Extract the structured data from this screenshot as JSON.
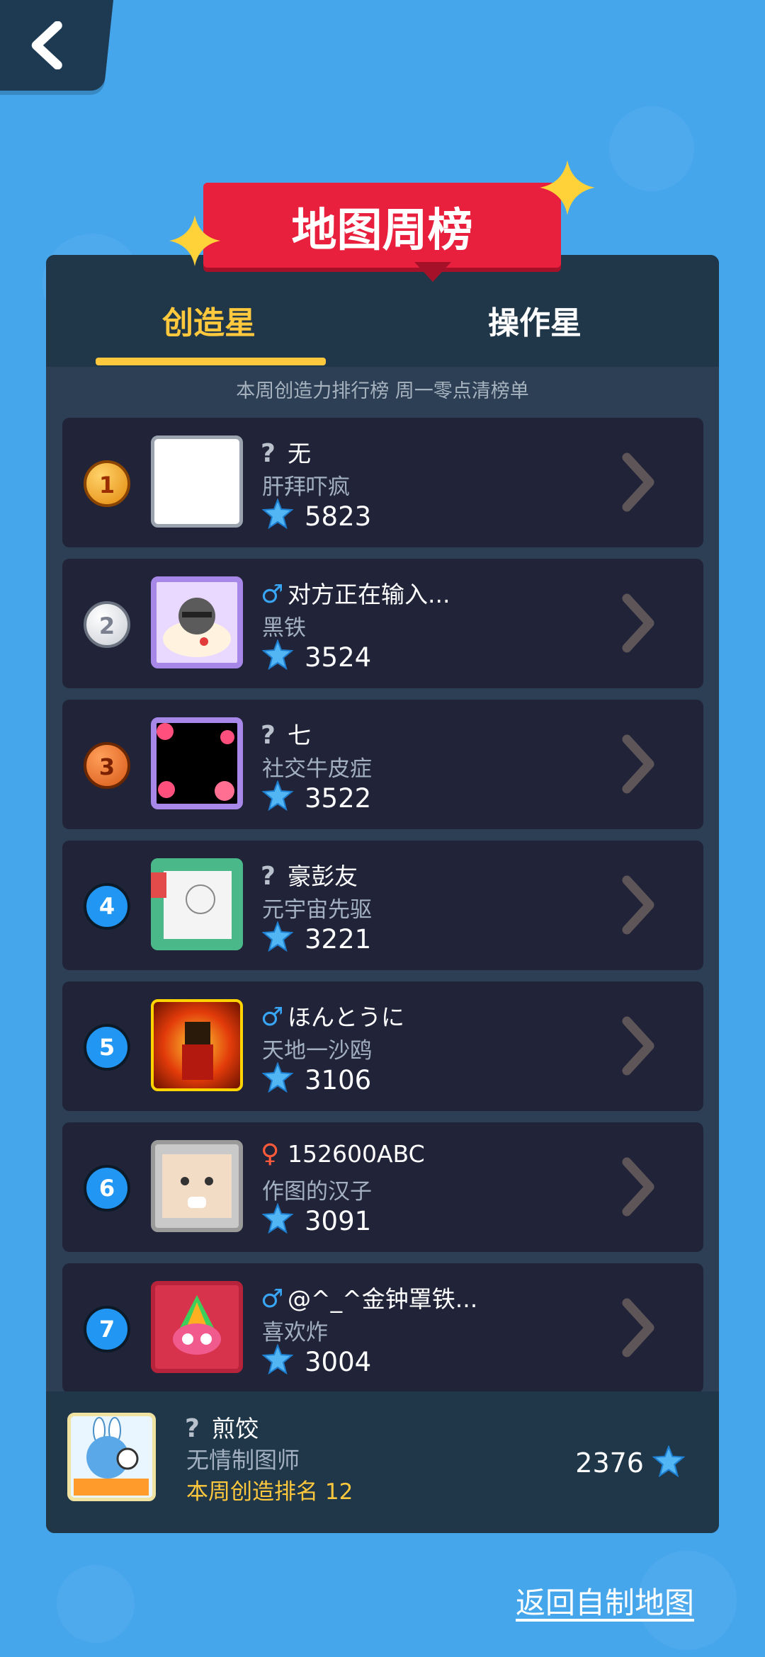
{
  "banner": {
    "title": "地图周榜"
  },
  "tabs": [
    {
      "label": "创造星",
      "active": true
    },
    {
      "label": "操作星",
      "active": false
    }
  ],
  "subtitle": "本周创造力排行榜 周一零点清榜单",
  "rows": [
    {
      "rank": "1",
      "gender": "?",
      "name": "无",
      "title": "肝拜吓疯",
      "score": "5823"
    },
    {
      "rank": "2",
      "gender": "♂",
      "name": "对方正在输入...",
      "title": "黑铁",
      "score": "3524"
    },
    {
      "rank": "3",
      "gender": "?",
      "name": "七",
      "title": "社交牛皮症",
      "score": "3522"
    },
    {
      "rank": "4",
      "gender": "?",
      "name": "豪彭友",
      "title": "元宇宙先驱",
      "score": "3221"
    },
    {
      "rank": "5",
      "gender": "♂",
      "name": "ほんとうに",
      "title": "天地一沙鸥",
      "score": "3106"
    },
    {
      "rank": "6",
      "gender": "♀",
      "name": "152600ABC",
      "title": "作图的汉子",
      "score": "3091"
    },
    {
      "rank": "7",
      "gender": "♂",
      "name": "@^_^金钟罩铁...",
      "title": "喜欢炸",
      "score": "3004"
    }
  ],
  "me": {
    "gender": "?",
    "name": "煎饺",
    "title": "无情制图师",
    "rank_text": "本周创造排名 12",
    "score": "2376"
  },
  "return_link": "返回自制地图",
  "colors": {
    "background": "#45a6ec",
    "panel": "#2c3f55",
    "row": "#212438",
    "accent": "#ffc83d",
    "banner": "#e8203e"
  },
  "icons": {
    "back": "chevron-left-icon",
    "score": "blue-star-gem-icon",
    "row_arrow": "chevron-right-icon"
  }
}
